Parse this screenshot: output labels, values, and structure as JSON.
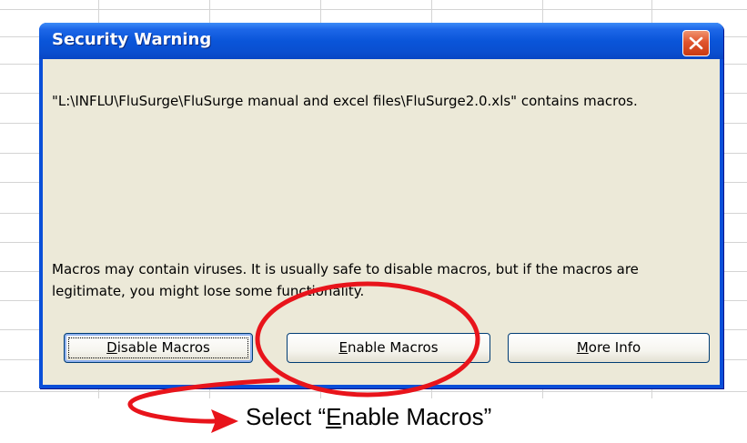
{
  "dialog": {
    "title": "Security Warning",
    "message_path": "\"L:\\INFLU\\FluSurge\\FluSurge manual and excel files\\FluSurge2.0.xls\" contains macros.",
    "message_warning": "Macros may contain viruses. It is usually safe to disable macros, but if the macros are legitimate, you might lose some functionality.",
    "buttons": {
      "disable": {
        "mnemonic": "D",
        "rest": "isable Macros"
      },
      "enable": {
        "mnemonic": "E",
        "rest": "nable Macros"
      },
      "more": {
        "mnemonic": "M",
        "rest": "ore Info"
      }
    }
  },
  "annotation": {
    "caption_prefix": "Select “",
    "caption_mnemonic": "E",
    "caption_rest": "nable Macros”",
    "color": "#e8141b"
  },
  "colors": {
    "titlebar": "#0A4FD8",
    "dialog_face": "#ECE9D8",
    "close_button": "#E0552E",
    "grid_lines": "#D4D4D4"
  },
  "icons": {
    "close": "close-icon",
    "arrow": "red-arrow"
  }
}
